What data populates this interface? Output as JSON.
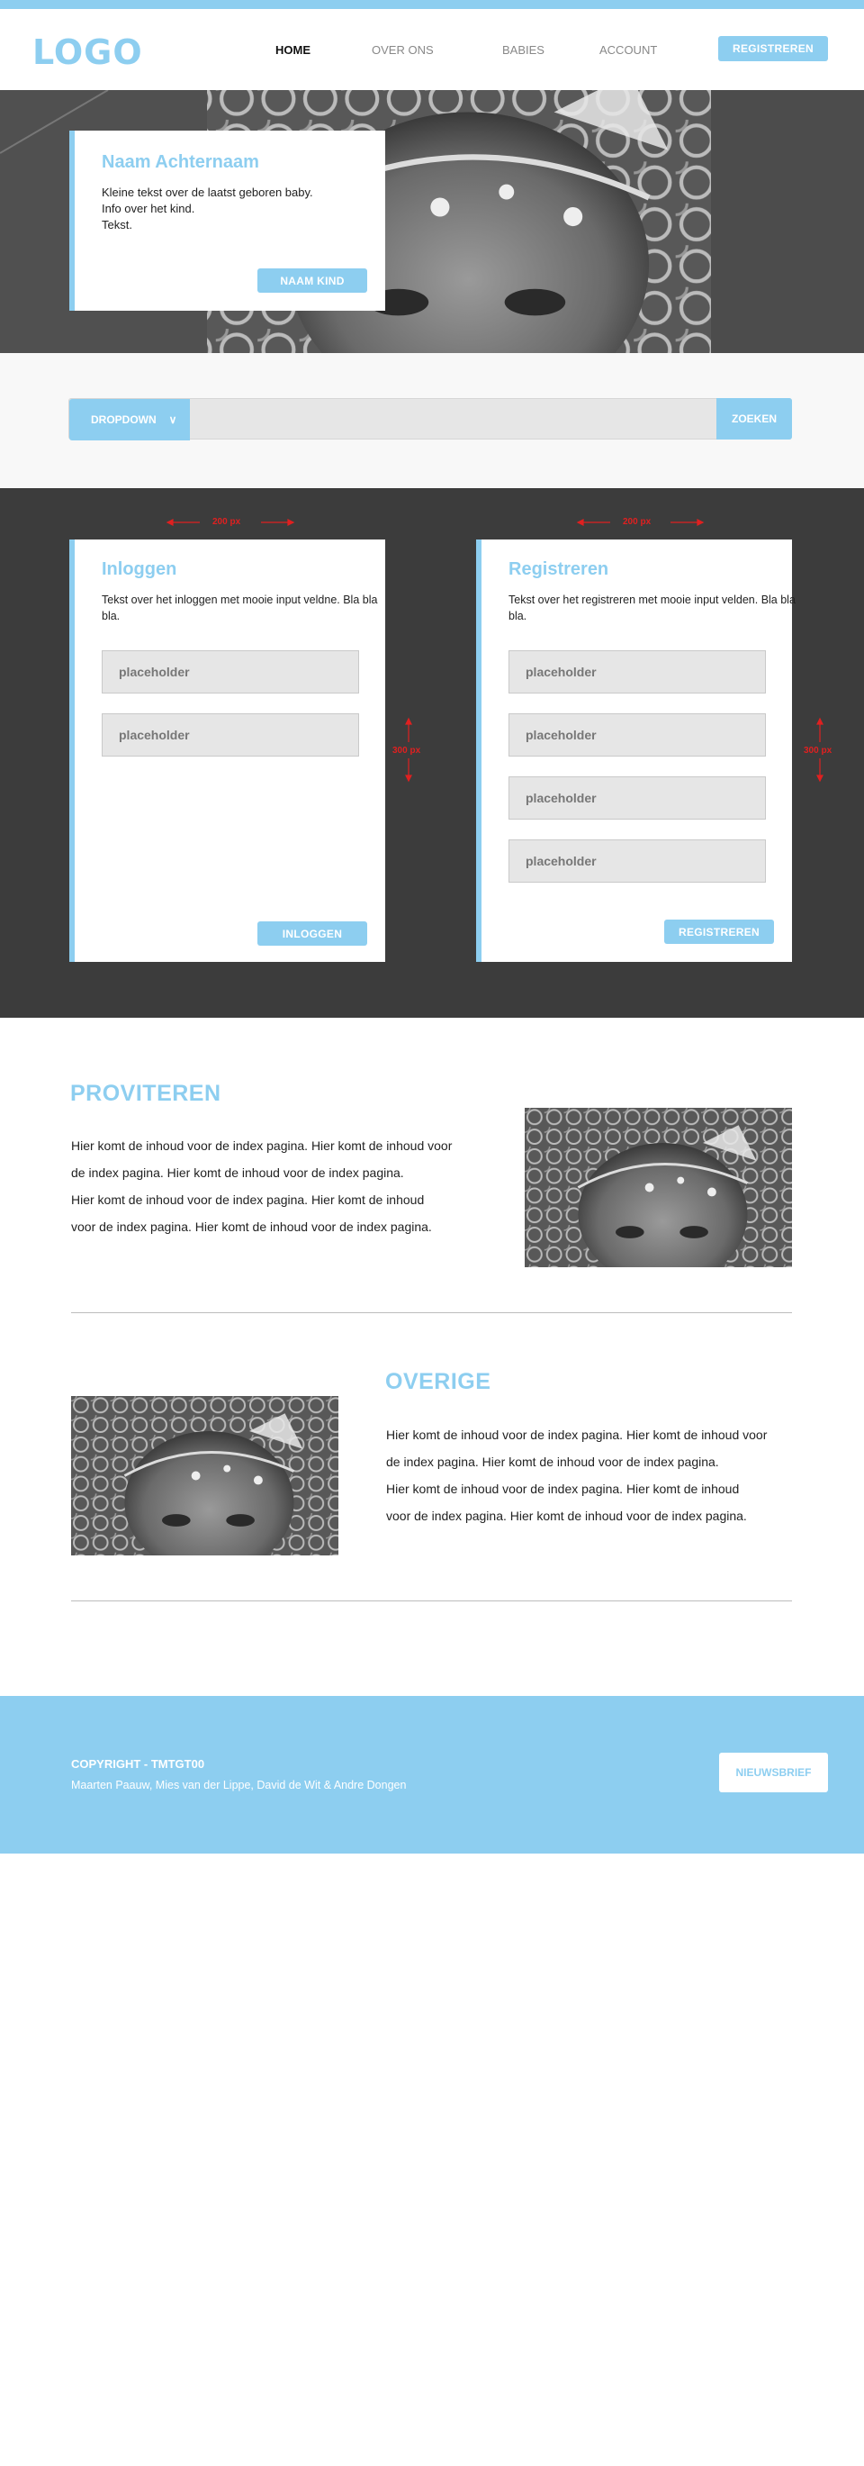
{
  "colors": {
    "accent": "#8dcef0",
    "dark_band": "#3c3c3c",
    "measure": "#e02020"
  },
  "header": {
    "logo": "LOGO",
    "nav": [
      {
        "label": "HOME"
      },
      {
        "label": "OVER ONS"
      },
      {
        "label": "BABIES"
      },
      {
        "label": "ACCOUNT"
      }
    ],
    "register_label": "REGISTREREN"
  },
  "hero": {
    "name": "Naam Achternaam",
    "description": "Kleine tekst over de laatst geboren baby.\nInfo over het kind.\nTekst.",
    "button_label": "NAAM KIND"
  },
  "search": {
    "dropdown_label": "DROPDOWN",
    "button_label": "ZOEKEN"
  },
  "measures": {
    "width_label": "200 px",
    "height_label": "300 px"
  },
  "login": {
    "title": "Inloggen",
    "text": "Tekst over het inloggen met mooie input veldne. Bla bla bla.",
    "fields": [
      "placeholder",
      "placeholder"
    ],
    "button_label": "INLOGGEN"
  },
  "register": {
    "title": "Registreren",
    "text": "Tekst over het registreren met mooie input velden. Bla bla bla.",
    "fields": [
      "placeholder",
      "placeholder",
      "placeholder",
      "placeholder"
    ],
    "button_label": "REGISTREREN"
  },
  "sections": [
    {
      "title": "PROVITEREN",
      "text": "Hier komt de inhoud voor de index pagina. Hier komt de inhoud voor\nde index pagina. Hier komt de inhoud voor de index pagina.\nHier komt de inhoud voor de index pagina. Hier komt de inhoud\nvoor de index pagina. Hier komt de inhoud voor de index pagina."
    },
    {
      "title": "OVERIGE",
      "text": "Hier komt de inhoud voor de index pagina. Hier komt de inhoud voor\nde index pagina. Hier komt de inhoud voor de index pagina.\nHier komt de inhoud voor de index pagina. Hier komt de inhoud\nvoor de index pagina. Hier komt de inhoud voor de index pagina."
    }
  ],
  "footer": {
    "copyright": "COPYRIGHT - TMTGT00",
    "credits": "Maarten Paauw, Mies van der Lippe, David de Wit & Andre Dongen",
    "newsletter_label": "NIEUWSBRIEF"
  }
}
